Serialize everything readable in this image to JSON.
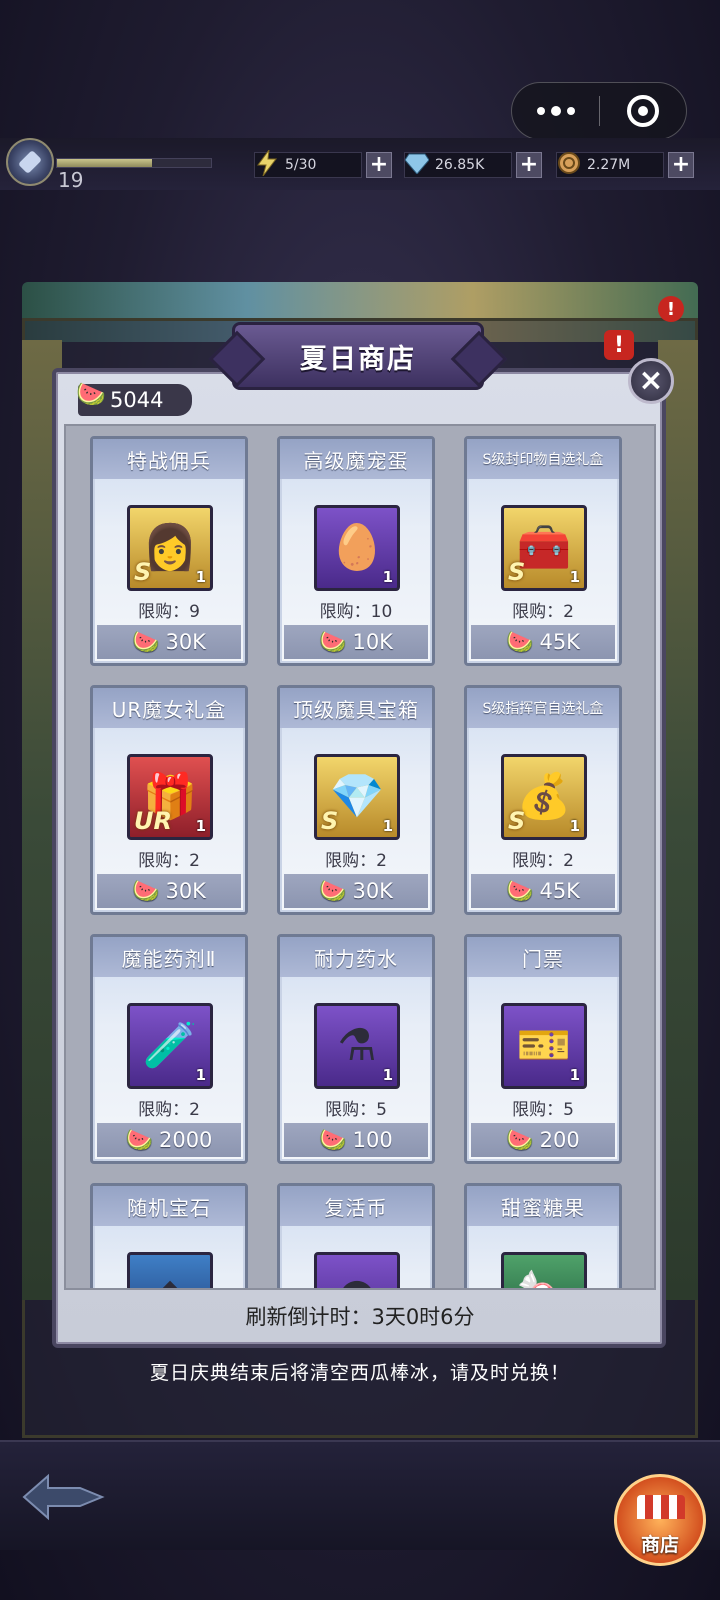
{
  "topbar": {
    "level": "19",
    "xp_progress": 0.62,
    "energy": "5/30",
    "diamonds": "26.85K",
    "coins": "2.27M",
    "plus": "+"
  },
  "shop": {
    "title": "夏日商店",
    "currency_amount": "5044",
    "close": "×",
    "refresh_text": "刷新倒计时：3天0时6分",
    "notice": "夏日庆典结束后将清空西瓜棒冰，请及时兑换！",
    "items": [
      {
        "name": "特战佣兵",
        "limit": "限购：9",
        "price": "30K",
        "qty": "1",
        "grade": "S",
        "frame": "gold",
        "icon": "mercenary-portrait-icon"
      },
      {
        "name": "高级魔宠蛋",
        "limit": "限购：10",
        "price": "10K",
        "qty": "1",
        "grade": "",
        "frame": "purple",
        "icon": "egg-icon"
      },
      {
        "name": "S级封印物自选礼盒",
        "limit": "限购：2",
        "price": "45K",
        "qty": "1",
        "grade": "S",
        "frame": "gold",
        "icon": "treasure-chest-icon"
      },
      {
        "name": "UR魔女礼盒",
        "limit": "限购：2",
        "price": "30K",
        "qty": "1",
        "grade": "UR",
        "frame": "red",
        "icon": "gift-box-icon"
      },
      {
        "name": "顶级魔具宝箱",
        "limit": "限购：2",
        "price": "30K",
        "qty": "1",
        "grade": "S",
        "frame": "gold",
        "icon": "purple-chest-icon"
      },
      {
        "name": "S级指挥官自选礼盒",
        "limit": "限购：2",
        "price": "45K",
        "qty": "1",
        "grade": "S",
        "frame": "gold",
        "icon": "gold-bag-icon"
      },
      {
        "name": "魔能药剂Ⅱ",
        "limit": "限购：2",
        "price": "2000",
        "qty": "1",
        "grade": "",
        "frame": "purple",
        "icon": "red-potion-icon"
      },
      {
        "name": "耐力药水",
        "limit": "限购：5",
        "price": "100",
        "qty": "1",
        "grade": "",
        "frame": "purple",
        "icon": "blue-potion-icon"
      },
      {
        "name": "门票",
        "limit": "限购：5",
        "price": "200",
        "qty": "1",
        "grade": "",
        "frame": "purple",
        "icon": "ticket-icon"
      },
      {
        "name": "随机宝石",
        "frame": "blue",
        "icon": "gem-icon"
      },
      {
        "name": "复活币",
        "frame": "purple",
        "icon": "revive-coin-icon"
      },
      {
        "name": "甜蜜糖果",
        "frame": "green",
        "icon": "candy-icon"
      }
    ]
  },
  "bottom": {
    "shop_label": "商店"
  },
  "colors": {
    "panel_border": "#4a4660",
    "title_plate": "#5a4a82",
    "price_bar": "#9ea6bf"
  }
}
